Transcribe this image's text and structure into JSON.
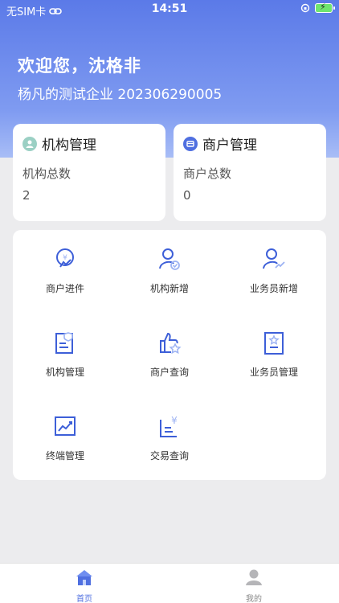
{
  "status": {
    "carrier": "无SIM卡",
    "time": "14:51"
  },
  "header": {
    "greeting": "欢迎您，沈格非",
    "company": "杨凡的测试企业 202306290005"
  },
  "org_card": {
    "title": "机构管理",
    "label": "机构总数",
    "value": "2"
  },
  "merchant_card": {
    "title": "商户管理",
    "label": "商户总数",
    "value": "0"
  },
  "menu": [
    {
      "label": "商户进件",
      "icon": "merchant-onboard-icon"
    },
    {
      "label": "机构新增",
      "icon": "add-org-icon"
    },
    {
      "label": "业务员新增",
      "icon": "add-salesman-icon"
    },
    {
      "label": "机构管理",
      "icon": "org-manage-icon"
    },
    {
      "label": "商户查询",
      "icon": "merchant-query-icon"
    },
    {
      "label": "业务员管理",
      "icon": "salesman-manage-icon"
    },
    {
      "label": "终端管理",
      "icon": "terminal-manage-icon"
    },
    {
      "label": "交易查询",
      "icon": "transaction-query-icon"
    }
  ],
  "tabbar": {
    "home": "首页",
    "me": "我的"
  },
  "colors": {
    "accent": "#4f6fe0",
    "icon_blue": "#3d5fd8",
    "icon_light": "#9db3f3"
  }
}
